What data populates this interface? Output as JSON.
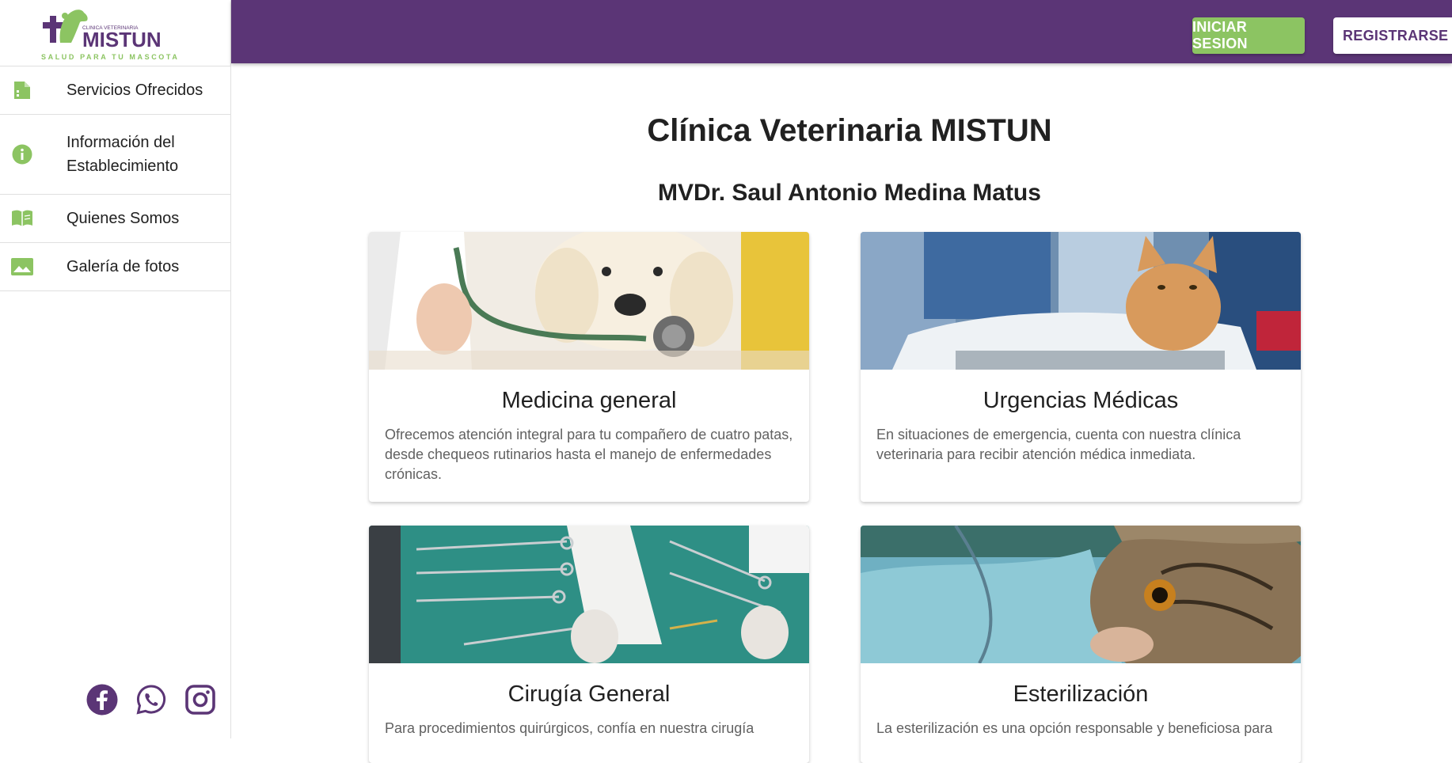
{
  "brand": {
    "small_line": "CLINICA VETERINARIA",
    "name": "MISTUN",
    "tagline": "SALUD PARA TU MASCOTA"
  },
  "sidebar": {
    "items": [
      {
        "label": "Servicios Ofrecidos",
        "icon": "document-icon"
      },
      {
        "label": "Información del Establecimiento",
        "icon": "info-icon"
      },
      {
        "label": "Quienes Somos",
        "icon": "book-icon"
      },
      {
        "label": "Galería de fotos",
        "icon": "image-icon"
      }
    ],
    "social": [
      "facebook-icon",
      "whatsapp-icon",
      "instagram-icon"
    ]
  },
  "header": {
    "login_label": "INICIAR SESION",
    "register_label": "REGISTRARSE"
  },
  "main": {
    "title": "Clínica Veterinaria MISTUN",
    "subtitle": "MVDr. Saul Antonio Medina Matus",
    "cards": [
      {
        "title": "Medicina general",
        "description": "Ofrecemos atención integral para tu compañero de cuatro patas, desde chequeos rutinarios hasta el manejo de enfermedades crónicas."
      },
      {
        "title": "Urgencias Médicas",
        "description": "En situaciones de emergencia, cuenta con nuestra clínica veterinaria para recibir atención médica inmediata."
      },
      {
        "title": "Cirugía General",
        "description": "Para procedimientos quirúrgicos, confía en nuestra cirugía"
      },
      {
        "title": "Esterilización",
        "description": "La esterilización es una opción responsable y beneficiosa para"
      }
    ]
  },
  "colors": {
    "primary": "#5b3576",
    "accent": "#8cc462"
  }
}
